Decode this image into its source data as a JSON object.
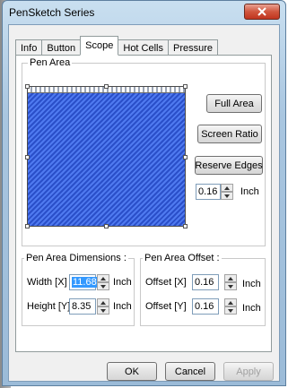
{
  "window": {
    "title": "PenSketch Series",
    "close_icon": "close-icon"
  },
  "tabs": [
    {
      "label": "Info",
      "active": false
    },
    {
      "label": "Button",
      "active": false
    },
    {
      "label": "Scope",
      "active": true
    },
    {
      "label": "Hot Cells",
      "active": false
    },
    {
      "label": "Pressure",
      "active": false
    }
  ],
  "pen_area": {
    "group_label": "Pen Area",
    "canvas_color": "#2c56d6",
    "buttons": {
      "full_area": "Full Area",
      "screen_ratio": "Screen Ratio",
      "reserve_edges": "Reserve Edges"
    },
    "reserve": {
      "value": "0.16",
      "unit": "Inch"
    }
  },
  "dimensions": {
    "group_label": "Pen Area Dimensions :",
    "width_label": "Width [X]",
    "width_value": "11.68",
    "width_unit": "Inch",
    "height_label": "Height [Y]",
    "height_value": "8.35",
    "height_unit": "Inch"
  },
  "offset": {
    "group_label": "Pen Area Offset :",
    "x_label": "Offset [X]",
    "x_value": "0.16",
    "x_unit": "Inch",
    "y_label": "Offset [Y]",
    "y_value": "0.16",
    "y_unit": "Inch"
  },
  "footer": {
    "ok": "OK",
    "cancel": "Cancel",
    "apply": "Apply"
  },
  "colors": {
    "selection": "#3399ff",
    "title_gradient": "#a9c6e0",
    "close_button": "#d0563e"
  }
}
